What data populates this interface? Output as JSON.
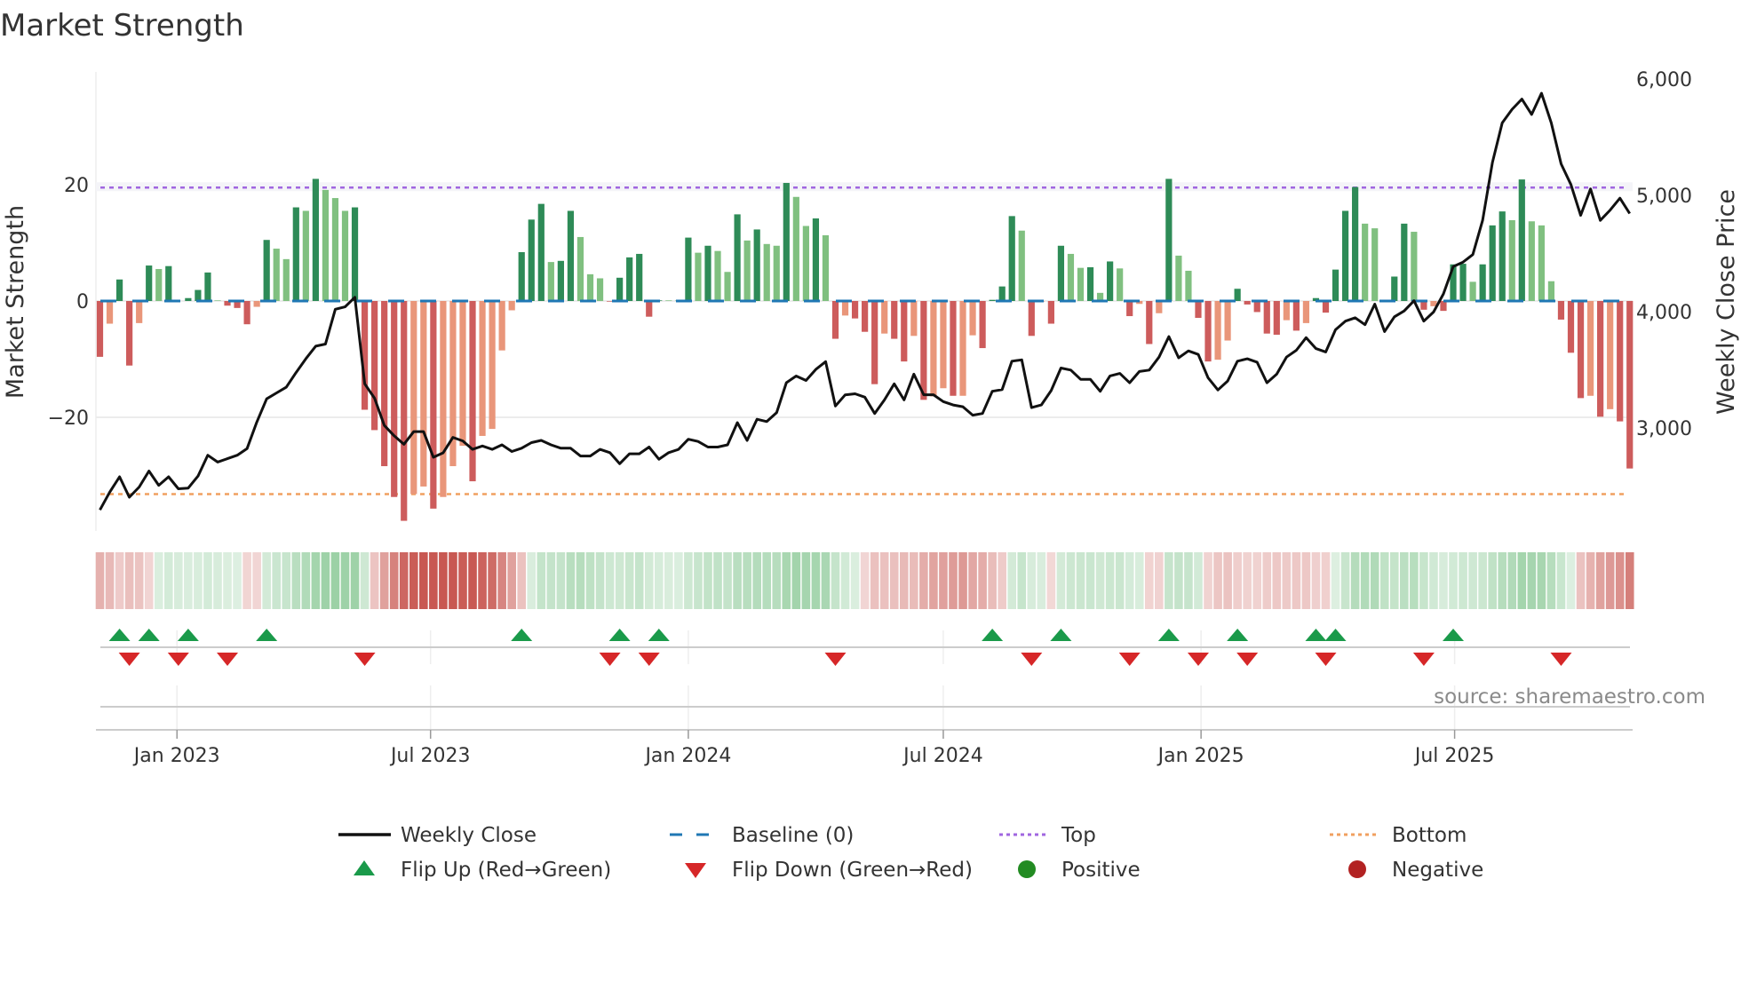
{
  "title": "Market Strength",
  "source": "source: sharemaestro.com",
  "chart_data": {
    "type": "bar+line",
    "title": "Market Strength",
    "x_start": "2022-11-07",
    "x_frequency": "weekly",
    "ylabel": "Market Strength",
    "y2label": "Weekly Close Price",
    "ylim": [
      -39,
      39
    ],
    "y2lim": [
      2100,
      6140
    ],
    "y_ticks": [
      {
        "value": 20,
        "label": "20"
      },
      {
        "value": 0,
        "label": "0"
      },
      {
        "value": -20,
        "label": "−20"
      }
    ],
    "y2_ticks": [
      {
        "value": 6000,
        "label": "6,000"
      },
      {
        "value": 5000,
        "label": "5,000"
      },
      {
        "value": 4000,
        "label": "4,000"
      },
      {
        "value": 3000,
        "label": "3,000"
      }
    ],
    "x_ticks": [
      {
        "date": "2023-01-01",
        "label": "Jan 2023"
      },
      {
        "date": "2023-07-01",
        "label": "Jul 2023"
      },
      {
        "date": "2024-01-01",
        "label": "Jan 2024"
      },
      {
        "date": "2024-07-01",
        "label": "Jul 2024"
      },
      {
        "date": "2025-01-01",
        "label": "Jan 2025"
      },
      {
        "date": "2025-07-01",
        "label": "Jul 2025"
      }
    ],
    "top_level": 19.5,
    "bottom_level": -33.2,
    "baseline": 0,
    "strength": [
      -9.6,
      -3.9,
      3.7,
      -11.1,
      -3.8,
      6.1,
      5.5,
      6,
      0,
      0.5,
      1.9,
      4.9,
      0.1,
      -0.8,
      -1.2,
      -4,
      -1,
      10.5,
      9,
      7.2,
      16.1,
      15.5,
      21,
      19.1,
      17.7,
      15.5,
      16.1,
      -18.7,
      -22.2,
      -28.4,
      -33.7,
      -37.8,
      -33.2,
      -31.9,
      -35.7,
      -33.7,
      -28.4,
      -24.9,
      -31,
      -23.2,
      -22,
      -8.5,
      -1.6,
      8.4,
      14,
      16.7,
      6.7,
      6.9,
      15.5,
      11,
      4.6,
      3.9,
      -0.1,
      4,
      7.5,
      8.1,
      -2.7,
      0.1,
      0.1,
      0.1,
      10.9,
      8.3,
      9.5,
      8.6,
      5,
      14.9,
      10.4,
      12.3,
      9.8,
      9.5,
      20.3,
      17.9,
      12.9,
      14.2,
      11.3,
      -6.5,
      -2.5,
      -3,
      -5.3,
      -14.3,
      -5.6,
      -6.5,
      -10.4,
      -6,
      -17,
      -16.4,
      -15,
      -16.3,
      -16.3,
      -5.9,
      -8.1,
      0.2,
      2.5,
      14.6,
      12.1,
      -6,
      -0.1,
      -3.9,
      9.5,
      8.1,
      5.7,
      5.8,
      1.4,
      6.8,
      5.6,
      -2.6,
      -0.5,
      -7.4,
      -2.1,
      21,
      7.8,
      5.2,
      -2.9,
      -10.4,
      -10.1,
      -6.8,
      2.1,
      -0.6,
      -1.9,
      -5.6,
      -5.8,
      -3.3,
      -5.1,
      -3.8,
      0.5,
      -2,
      5.4,
      15.5,
      19.6,
      13.3,
      12.5,
      0.1,
      4.2,
      13.3,
      11.9,
      -1.5,
      -0.9,
      -1.7,
      6.3,
      6.4,
      3.3,
      6.3,
      13,
      15.4,
      13.9,
      20.9,
      13.7,
      13,
      3.4,
      -3.2,
      -8.9,
      -16.7,
      -16.3,
      -19.9,
      -18.6,
      -20.7,
      -28.8
    ],
    "weekly_close": [
      2294,
      2447,
      2579,
      2403,
      2491,
      2629,
      2506,
      2579,
      2476,
      2482,
      2585,
      2765,
      2706,
      2735,
      2765,
      2821,
      3050,
      3250,
      3300,
      3350,
      3476,
      3594,
      3703,
      3721,
      4021,
      4041,
      4124,
      3379,
      3256,
      3021,
      2932,
      2859,
      2968,
      2968,
      2747,
      2785,
      2918,
      2888,
      2815,
      2844,
      2815,
      2854,
      2797,
      2825,
      2873,
      2892,
      2854,
      2825,
      2825,
      2758,
      2758,
      2815,
      2787,
      2691,
      2777,
      2777,
      2835,
      2730,
      2787,
      2815,
      2902,
      2883,
      2835,
      2835,
      2854,
      3045,
      2892,
      3074,
      3054,
      3131,
      3389,
      3446,
      3408,
      3503,
      3570,
      3188,
      3284,
      3293,
      3264,
      3124,
      3241,
      3379,
      3241,
      3462,
      3285,
      3285,
      3226,
      3197,
      3182,
      3109,
      3124,
      3315,
      3329,
      3574,
      3585,
      3174,
      3197,
      3321,
      3515,
      3497,
      3418,
      3418,
      3315,
      3447,
      3468,
      3388,
      3485,
      3497,
      3609,
      3785,
      3603,
      3662,
      3632,
      3432,
      3326,
      3403,
      3574,
      3594,
      3565,
      3388,
      3462,
      3609,
      3668,
      3776,
      3682,
      3653,
      3844,
      3918,
      3947,
      3888,
      4065,
      3829,
      3956,
      4006,
      4094,
      3918,
      3997,
      4153,
      4388,
      4426,
      4491,
      4785,
      5285,
      5624,
      5741,
      5829,
      5697,
      5879,
      5624,
      5271,
      5094,
      4829,
      5056,
      4785,
      4874,
      4976,
      4844
    ],
    "flip_up_weeks": [
      2,
      5,
      9,
      17,
      43,
      53,
      57,
      91,
      98,
      109,
      116,
      124,
      126,
      138
    ],
    "flip_down_weeks": [
      3,
      8,
      13,
      27,
      52,
      56,
      75,
      95,
      105,
      112,
      117,
      125,
      135,
      149
    ],
    "legend_position": "bottom",
    "legend": [
      {
        "key": "close",
        "label": "Weekly Close"
      },
      {
        "key": "baseline",
        "label": "Baseline (0)"
      },
      {
        "key": "top",
        "label": "Top"
      },
      {
        "key": "bottom",
        "label": "Bottom"
      },
      {
        "key": "flip_up",
        "label": "Flip Up (Red→Green)"
      },
      {
        "key": "flip_down",
        "label": "Flip Down (Green→Red)"
      },
      {
        "key": "positive",
        "label": "Positive"
      },
      {
        "key": "negative",
        "label": "Negative"
      }
    ],
    "colors": {
      "pos_strong": "#2e8b57",
      "pos_weak": "#80c080",
      "neg_strong": "#cd5c5c",
      "neg_weak": "#e9967a",
      "close": "#111111",
      "baseline": "#1f77b4",
      "top": "#a066e0",
      "bottom": "#f0a060",
      "flip_up": "#1a9a4a",
      "flip_down": "#d62728",
      "positive": "#228b22",
      "negative": "#b22222"
    }
  }
}
